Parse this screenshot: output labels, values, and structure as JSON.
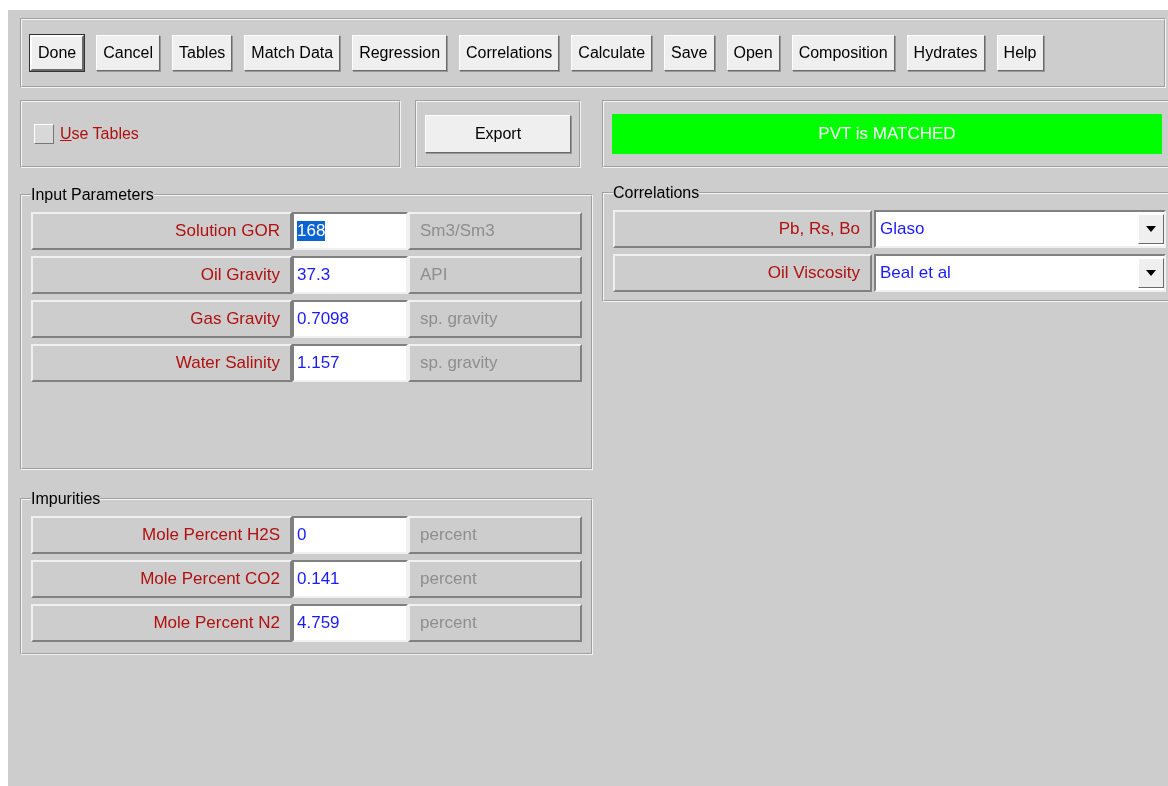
{
  "toolbar": [
    {
      "label": "Done",
      "default": true
    },
    {
      "label": "Cancel",
      "default": false
    },
    {
      "label": "Tables",
      "default": false
    },
    {
      "label": "Match Data",
      "default": false
    },
    {
      "label": "Regression",
      "default": false
    },
    {
      "label": "Correlations",
      "default": false
    },
    {
      "label": "Calculate",
      "default": false
    },
    {
      "label": "Save",
      "default": false
    },
    {
      "label": "Open",
      "default": false
    },
    {
      "label": "Composition",
      "default": false
    },
    {
      "label": "Hydrates",
      "default": false
    },
    {
      "label": "Help",
      "default": false
    }
  ],
  "use_tables": {
    "label": "Use Tables",
    "checked": false
  },
  "export_button": "Export",
  "status": {
    "text": "PVT is MATCHED",
    "color": "#00ff00"
  },
  "input_parameters": {
    "title": "Input Parameters",
    "rows": [
      {
        "label": "Solution GOR",
        "value": "168",
        "unit": "Sm3/Sm3",
        "highlighted": true
      },
      {
        "label": "Oil Gravity",
        "value": "37.3",
        "unit": "API",
        "highlighted": false
      },
      {
        "label": "Gas Gravity",
        "value": "0.7098",
        "unit": "sp. gravity",
        "highlighted": false
      },
      {
        "label": "Water Salinity",
        "value": "1.157",
        "unit": "sp. gravity",
        "highlighted": false
      }
    ]
  },
  "impurities": {
    "title": "Impurities",
    "rows": [
      {
        "label": "Mole Percent H2S",
        "value": "0",
        "unit": "percent",
        "highlighted": false
      },
      {
        "label": "Mole Percent CO2",
        "value": "0.141",
        "unit": "percent",
        "highlighted": false
      },
      {
        "label": "Mole Percent N2",
        "value": "4.759",
        "unit": "percent",
        "highlighted": false
      }
    ]
  },
  "correlations": {
    "title": "Correlations",
    "rows": [
      {
        "label": "Pb, Rs, Bo",
        "value": "Glaso"
      },
      {
        "label": "Oil Viscosity",
        "value": "Beal et al"
      }
    ]
  }
}
